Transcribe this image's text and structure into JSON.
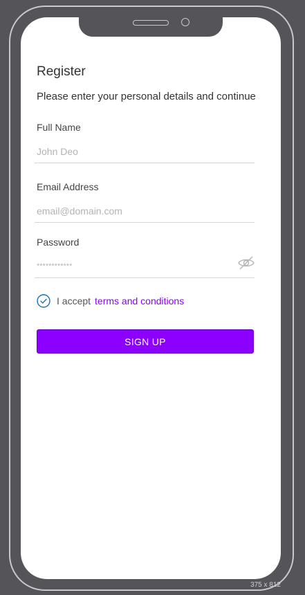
{
  "screen": {
    "title": "Register",
    "subtitle": "Please enter your personal details and continue"
  },
  "fields": {
    "full_name": {
      "label": "Full Name",
      "placeholder": "John Deo"
    },
    "email": {
      "label": "Email Address",
      "placeholder": "email@domain.com"
    },
    "password": {
      "label": "Password",
      "placeholder": "************"
    }
  },
  "terms": {
    "prefix": "I accept",
    "link_text": "terms and conditions",
    "checked": true
  },
  "signup_label": "SIGN UP",
  "canvas_size_label": "375 x 812",
  "colors": {
    "accent": "#8b00ff",
    "checkbox": "#1a73b5",
    "frame_background": "#555459"
  },
  "icons": {
    "password_toggle": "eye-off-icon",
    "checkbox": "check-circle-icon"
  }
}
